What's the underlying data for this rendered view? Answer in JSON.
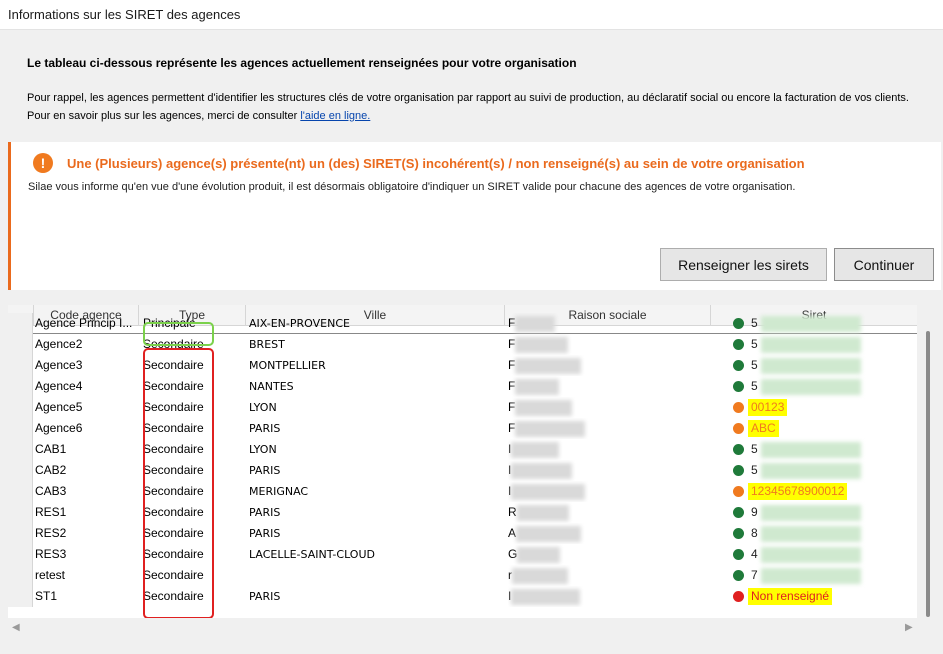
{
  "window": {
    "title": "Informations sur les SIRET des agences"
  },
  "intro": {
    "heading": "Le tableau ci-dessous représente les agences actuellement renseignées pour votre organisation",
    "line1": "Pour rappel, les agences permettent d'identifier les structures clés de votre organisation par rapport au suivi de production, au déclaratif social ou encore la facturation de vos clients.",
    "line2_prefix": "Pour en savoir plus sur les agences, merci de consulter ",
    "link": "l'aide en ligne."
  },
  "alert": {
    "icon": "!",
    "title": "Une (Plusieurs) agence(s) présente(nt) un (des) SIRET(S) incohérent(s) / non renseigné(s) au sein de votre organisation",
    "text": "Silae vous informe qu'en vue d'une évolution produit, il est désormais obligatoire d'indiquer un SIRET valide pour chacune des agences de votre organisation."
  },
  "buttons": {
    "renseigner": "Renseigner les sirets",
    "continuer": "Continuer"
  },
  "table": {
    "headers": [
      "Code agence",
      "Type",
      "Ville",
      "Raison sociale",
      "Siret"
    ],
    "rows": [
      {
        "code": "Agence Princip I...",
        "type": "Principale",
        "ville": "AIX-EN-PROVENCE",
        "rs": "F",
        "siret": "5",
        "status": "valid"
      },
      {
        "code": "Agence2",
        "type": "Secondaire",
        "ville": "BREST",
        "rs": "F",
        "siret": "5",
        "status": "valid"
      },
      {
        "code": "Agence3",
        "type": "Secondaire",
        "ville": "MONTPELLIER",
        "rs": "F",
        "siret": "5",
        "status": "valid"
      },
      {
        "code": "Agence4",
        "type": "Secondaire",
        "ville": "NANTES",
        "rs": "F",
        "siret": "5",
        "status": "valid"
      },
      {
        "code": "Agence5",
        "type": "Secondaire",
        "ville": "LYON",
        "rs": "F",
        "siret": "00123",
        "status": "invalid"
      },
      {
        "code": "Agence6",
        "type": "Secondaire",
        "ville": "PARIS",
        "rs": "F",
        "siret": "ABC",
        "status": "invalid"
      },
      {
        "code": "CAB1",
        "type": "Secondaire",
        "ville": "LYON",
        "rs": "I",
        "siret": "5",
        "status": "valid"
      },
      {
        "code": "CAB2",
        "type": "Secondaire",
        "ville": "PARIS",
        "rs": "I",
        "siret": "5",
        "status": "valid"
      },
      {
        "code": "CAB3",
        "type": "Secondaire",
        "ville": "MERIGNAC",
        "rs": "I",
        "siret": "12345678900012",
        "status": "invalid"
      },
      {
        "code": "RES1",
        "type": "Secondaire",
        "ville": "PARIS",
        "rs": "R",
        "siret": "9",
        "status": "valid"
      },
      {
        "code": "RES2",
        "type": "Secondaire",
        "ville": "PARIS",
        "rs": "A",
        "siret": "8",
        "status": "valid"
      },
      {
        "code": "RES3",
        "type": "Secondaire",
        "ville": "LACELLE-SAINT-CLOUD",
        "rs": "G",
        "siret": "4",
        "status": "valid"
      },
      {
        "code": "retest",
        "type": "Secondaire",
        "ville": "",
        "rs": "r",
        "siret": "7",
        "status": "valid"
      },
      {
        "code": "ST1",
        "type": "Secondaire",
        "ville": "PARIS",
        "rs": "I",
        "siret": "Non renseigné",
        "status": "missing"
      }
    ]
  },
  "colors": {
    "valid": "#1f7a3a",
    "invalid": "#f07a1f",
    "missing": "#e02020",
    "accent": "#ea6a1d"
  },
  "scroll": {
    "left_arrow": "◀",
    "right_arrow": "▶"
  }
}
